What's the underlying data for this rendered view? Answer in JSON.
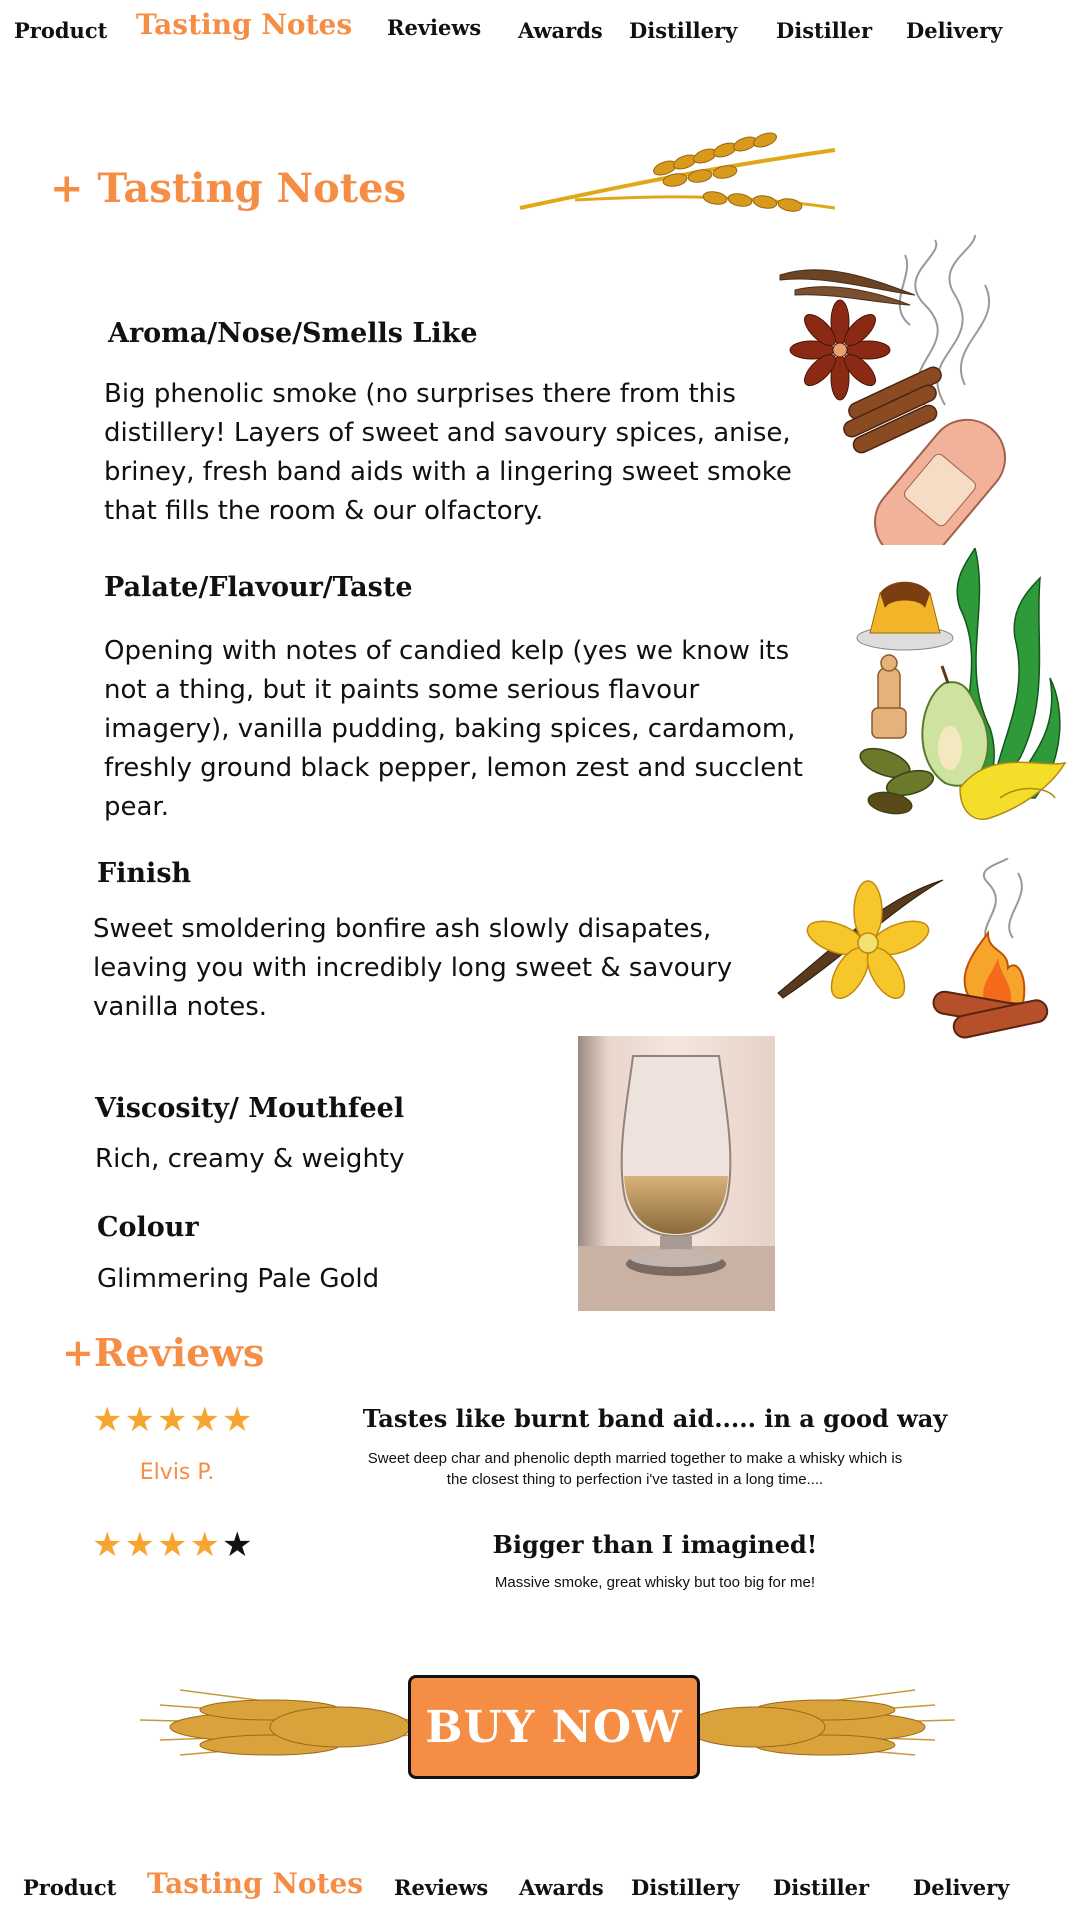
{
  "top_nav": {
    "items": [
      "Product",
      "Tasting Notes",
      "Reviews",
      "Awards",
      "Distillery",
      "Distiller",
      "Delivery"
    ],
    "active": "Tasting Notes"
  },
  "tasting": {
    "section_title": "+ Tasting Notes",
    "aroma": {
      "heading": "Aroma/Nose/Smells Like",
      "lines": [
        "Big phenolic smoke (no surprises there from this",
        "distillery! Layers of sweet and savoury spices, anise,",
        "briney, fresh band aids with a lingering sweet smoke",
        "that fills the room & our olfactory."
      ]
    },
    "palate": {
      "heading": "Palate/Flavour/Taste",
      "lines": [
        "Opening with notes of candied kelp (yes we know its",
        "not a thing, but it paints some serious flavour",
        "imagery), vanilla pudding, baking spices, cardamom,",
        "freshly ground black pepper, lemon zest and succlent",
        "pear."
      ]
    },
    "finish": {
      "heading": "Finish",
      "lines": [
        "Sweet smoldering bonfire ash slowly disapates,",
        "leaving you with incredibly long sweet & savoury",
        "vanilla notes."
      ]
    },
    "viscosity": {
      "heading": "Viscosity/ Mouthfeel",
      "text": "Rich, creamy & weighty"
    },
    "colour": {
      "heading": "Colour",
      "text": "Glimmering Pale Gold"
    }
  },
  "reviews": {
    "section_title": "+Reviews",
    "items": [
      {
        "rating": 5,
        "max": 5,
        "author": "Elvis P.",
        "title": "Tastes like burnt band aid..... in a good way",
        "body_lines": [
          "Sweet deep char and phenolic depth married together to make a whisky which is",
          "the closest thing to perfection i've tasted in a long time...."
        ]
      },
      {
        "rating": 4,
        "max": 5,
        "title": "Bigger than I imagined!",
        "body_lines": [
          "Massive smoke, great whisky but too big for me!"
        ]
      }
    ]
  },
  "cta": {
    "label": "BUY NOW"
  },
  "bottom_nav": {
    "items": [
      "Product",
      "Tasting Notes",
      "Reviews",
      "Awards",
      "Distillery",
      "Distiller",
      "Delivery"
    ],
    "active": "Tasting Notes"
  },
  "icons": {
    "wheat": "wheat-icon",
    "spices": "spices-illustration",
    "palate": "flavour-illustration",
    "finish": "vanilla-bonfire-illustration",
    "glass": "whisky-glass-photo",
    "star": "star-icon"
  },
  "colors": {
    "accent": "#F58D45",
    "star": "#F7A531",
    "text": "#111111"
  }
}
